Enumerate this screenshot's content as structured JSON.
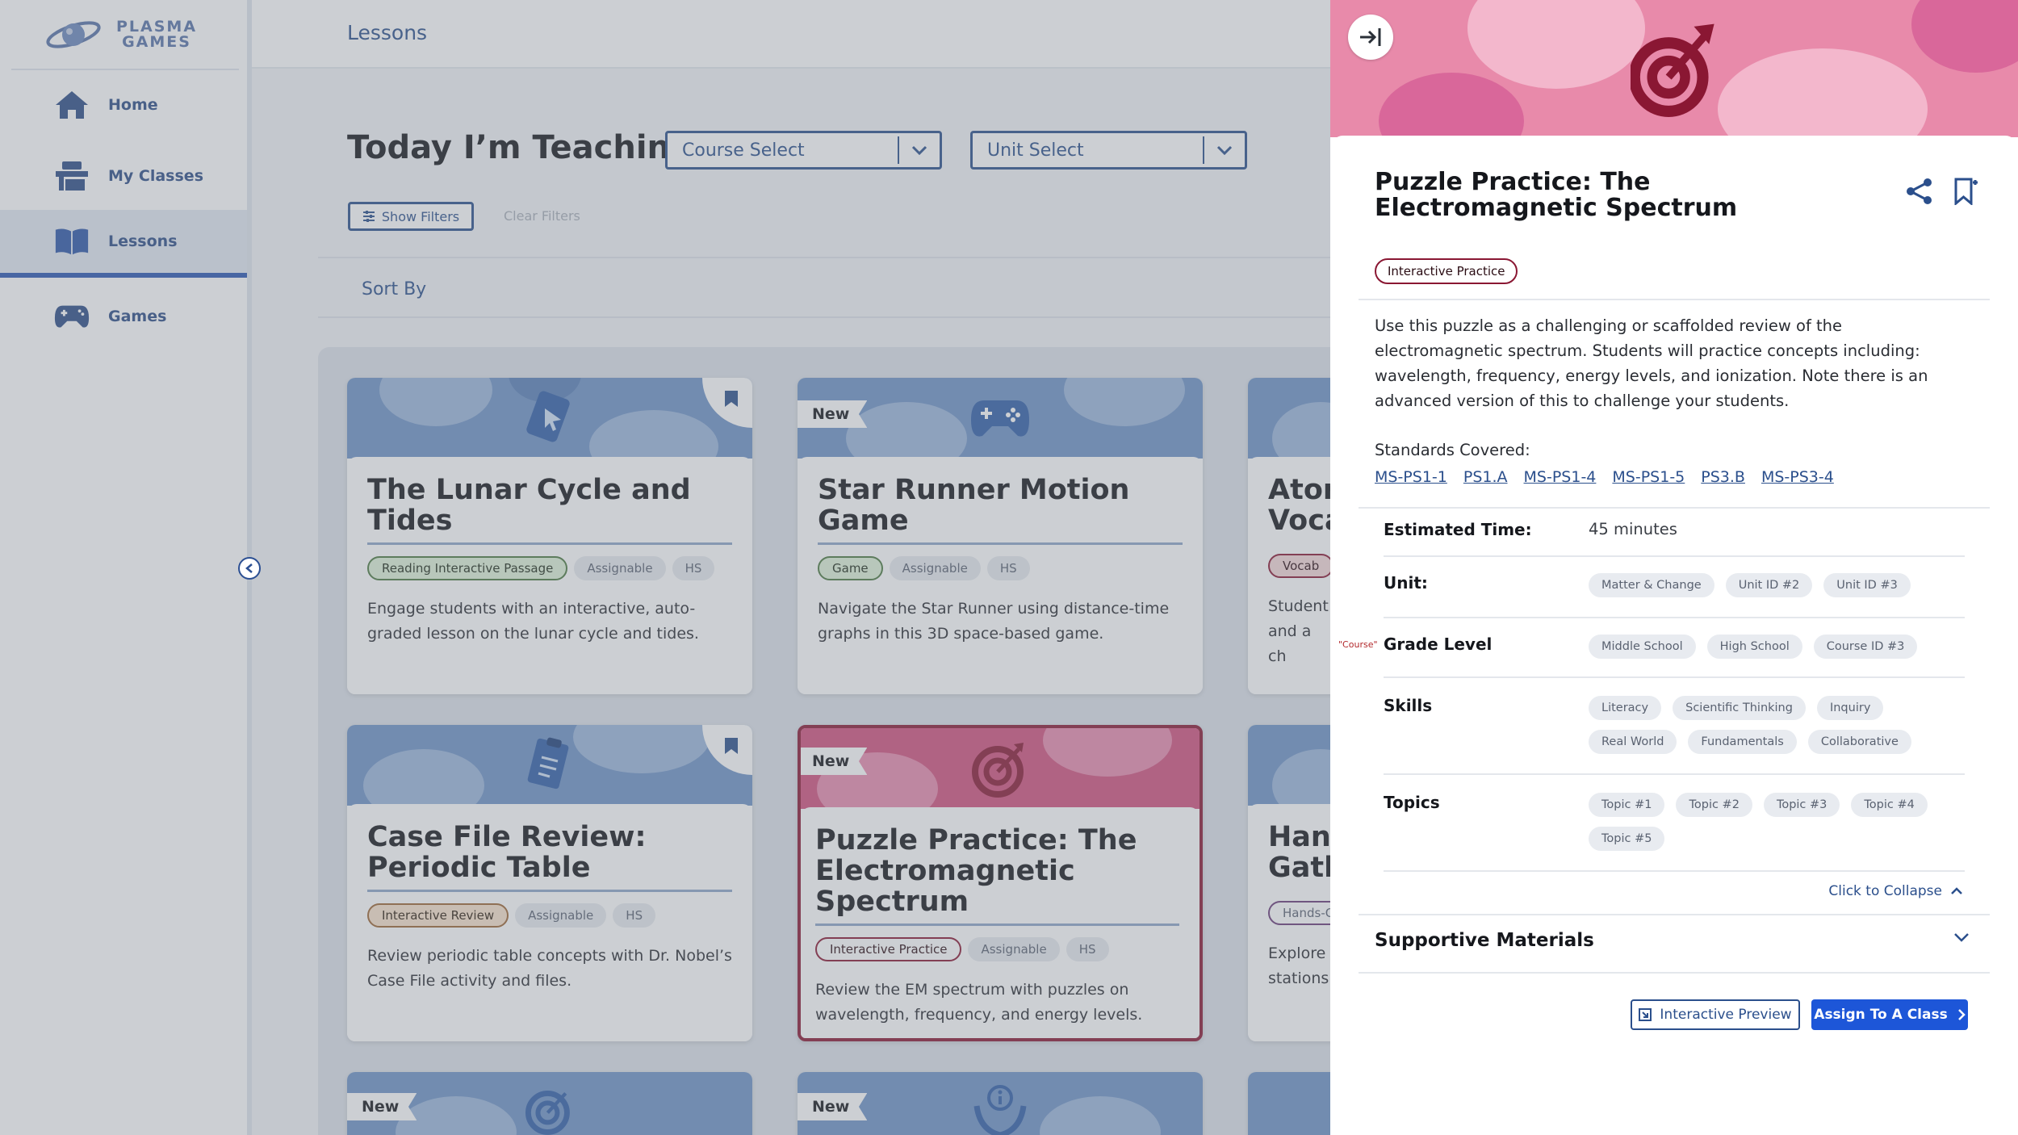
{
  "brand": {
    "line1": "PLASMA",
    "line2": "GAMES"
  },
  "nav": [
    {
      "label": "Home",
      "icon": "home-icon"
    },
    {
      "label": "My Classes",
      "icon": "desk-icon"
    },
    {
      "label": "Lessons",
      "icon": "book-icon"
    },
    {
      "label": "Games",
      "icon": "gamepad-icon"
    }
  ],
  "header": {
    "title": "Lessons"
  },
  "main": {
    "title": "Today I’m Teaching",
    "course_select": "Course Select",
    "unit_select": "Unit Select",
    "show_filters": "Show Filters",
    "clear_filters": "Clear Filters",
    "sort_by": "Sort By"
  },
  "cards": [
    {
      "title": "The Lunar Cycle and Tides",
      "tags": [
        "Reading Interactive Passage",
        "Assignable",
        "HS"
      ],
      "desc": "Engage students with an interactive, auto-graded lesson on the lunar cycle and tides."
    },
    {
      "badge": "New",
      "title": "Star Runner Motion Game",
      "tags": [
        "Game",
        "Assignable",
        "HS"
      ],
      "desc": "Navigate the Star Runner using distance-time graphs in this 3D space-based game."
    },
    {
      "title": "Aton Voca",
      "tags": [
        "Vocab"
      ],
      "desc": "Student and a ch"
    },
    {
      "title": "Case File Review: Periodic Table",
      "tags": [
        "Interactive Review",
        "Assignable",
        "HS"
      ],
      "desc": "Review periodic table concepts with Dr. Nobel’s Case File activity and files."
    },
    {
      "badge": "New",
      "title": "Puzzle Practice: The Electromagnetic Spectrum",
      "tags": [
        "Interactive Practice",
        "Assignable",
        "HS"
      ],
      "desc": "Review the EM spectrum with puzzles on wavelength, frequency, and energy levels."
    },
    {
      "title": "Hand Gath",
      "tags": [
        "Hands-C"
      ],
      "desc": "Explore stations"
    },
    {
      "badge": "New"
    },
    {
      "badge": "New"
    }
  ],
  "panel": {
    "title": "Puzzle Practice: The Electromagnetic Spectrum",
    "tag": "Interactive Practice",
    "description": "Use this puzzle as a challenging or scaffolded review of the electromagnetic spectrum. Students will practice concepts including: wavelength, frequency, energy levels, and ionization. Note there is an advanced version of this to challenge your students.",
    "standards_label": "Standards Covered:",
    "standards": [
      "MS-PS1-1",
      "PS1.A",
      "MS-PS1-4",
      "MS-PS1-5",
      "PS3.B",
      "MS-PS3-4"
    ],
    "estimated_time_label": "Estimated Time:",
    "estimated_time": "45 minutes",
    "unit_label": "Unit:",
    "units": [
      "Matter & Change",
      "Unit ID #2",
      "Unit ID #3"
    ],
    "course_note": "\"Course\"",
    "grade_label": "Grade Level",
    "grades": [
      "Middle School",
      "High School",
      "Course ID #3"
    ],
    "skills_label": "Skills",
    "skills": [
      "Literacy",
      "Scientific Thinking",
      "Inquiry",
      "Real World",
      "Fundamentals",
      "Collaborative"
    ],
    "topics_label": "Topics",
    "topics": [
      "Topic #1",
      "Topic #2",
      "Topic #3",
      "Topic #4",
      "Topic #5"
    ],
    "collapse": "Click to Collapse",
    "supportive": "Supportive Materials",
    "preview_button": "Interactive Preview",
    "assign_button": "Assign To A Class"
  },
  "colors": {
    "brand_blue": "#2b4f8c",
    "accent_maroon": "#8a1733",
    "primary_button": "#1d56d8"
  }
}
